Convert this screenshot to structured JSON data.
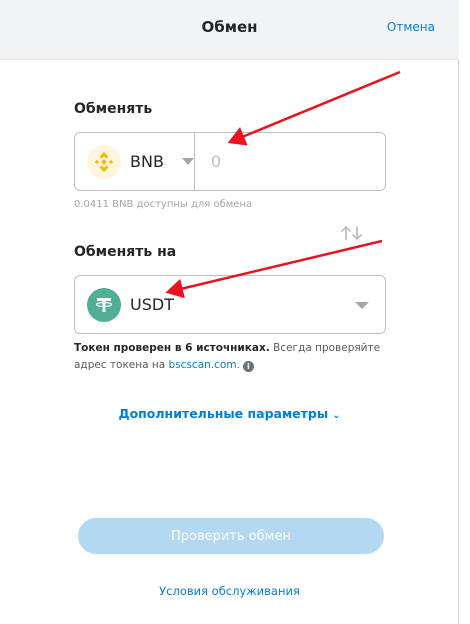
{
  "header": {
    "title": "Обмен",
    "cancel_label": "Отмена"
  },
  "from": {
    "label": "Обменять",
    "token_symbol": "BNB",
    "token_icon": "bnb-logo-icon",
    "amount_placeholder": "0",
    "balance_text": "0.0411 BNB доступны для обмена"
  },
  "to": {
    "label": "Обменять на",
    "token_symbol": "USDT",
    "token_icon": "tether-logo-icon",
    "verify_bold": "Токен проверен в 6 источниках.",
    "verify_text": " Всегда проверяйте адрес токена на ",
    "verify_link": "bscscan.com",
    "verify_end": "."
  },
  "advanced_label": "Дополнительные параметры",
  "review_button_label": "Проверить обмен",
  "terms_label": "Условия обслуживания",
  "colors": {
    "accent": "#037dd6",
    "annotation_arrow": "#e8131e",
    "bnb": "#f0b90b",
    "usdt": "#50af95",
    "button_disabled": "#b3d8f2"
  }
}
